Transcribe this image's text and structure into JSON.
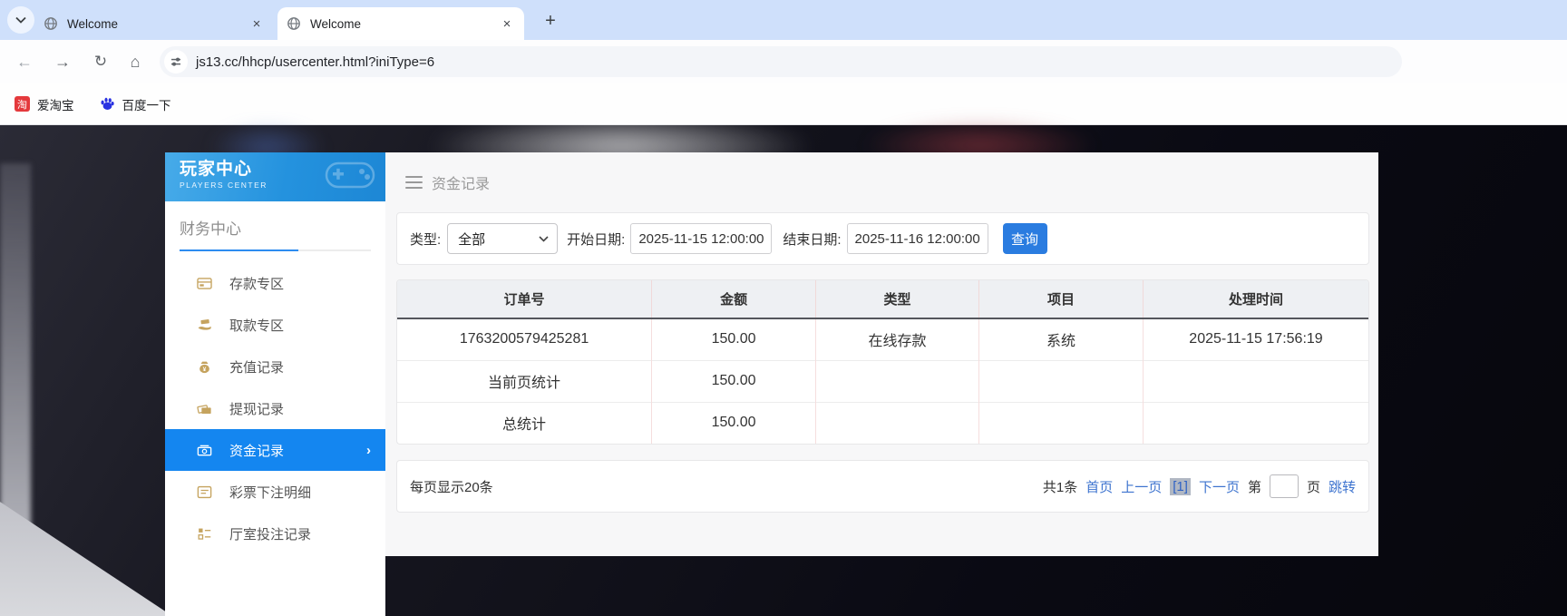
{
  "browser": {
    "tabs": [
      {
        "title": "Welcome"
      },
      {
        "title": "Welcome"
      }
    ],
    "url": "js13.cc/hhcp/usercenter.html?iniType=6",
    "bookmarks": [
      {
        "label": "爱淘宝"
      },
      {
        "label": "百度一下"
      }
    ]
  },
  "icons": {
    "close": "×",
    "new_tab": "+",
    "back": "←",
    "forward": "→",
    "reload": "↻",
    "home": "⌂",
    "taobao": "淘",
    "active_chevron": "›",
    "collapse_chevron": "›"
  },
  "sidebar": {
    "title": "玩家中心",
    "subtitle": "PLAYERS CENTER",
    "section": "财务中心",
    "items": [
      {
        "label": "存款专区"
      },
      {
        "label": "取款专区"
      },
      {
        "label": "充值记录"
      },
      {
        "label": "提现记录"
      },
      {
        "label": "资金记录"
      },
      {
        "label": "彩票下注明细"
      },
      {
        "label": "厅室投注记录"
      }
    ]
  },
  "main": {
    "title": "资金记录",
    "filter": {
      "type_label": "类型:",
      "type_value": "全部",
      "start_label": "开始日期:",
      "start_value": "2025-11-15 12:00:00",
      "end_label": "结束日期:",
      "end_value": "2025-11-16 12:00:00",
      "search_label": "查询"
    },
    "table": {
      "headers": [
        "订单号",
        "金额",
        "类型",
        "项目",
        "处理时间"
      ],
      "rows": [
        [
          "1763200579425281",
          "150.00",
          "在线存款",
          "系统",
          "2025-11-15 17:56:19"
        ],
        [
          "当前页统计",
          "150.00",
          "",
          "",
          ""
        ],
        [
          "总统计",
          "150.00",
          "",
          "",
          ""
        ]
      ]
    },
    "pagination": {
      "page_size": "每页显示20条",
      "total": "共1条",
      "first": "首页",
      "prev": "上一页",
      "current": "[1]",
      "next": "下一页",
      "jump_pre": "第",
      "jump_post": "页",
      "jump": "跳转"
    }
  },
  "colors": {
    "accent_blue": "#1486f0",
    "link_blue": "#3e74cf",
    "button_blue": "#2a7ce0",
    "icon_gold": "#c5a35e",
    "header_gradient_start": "#47abe9",
    "header_gradient_end": "#1d87d5"
  }
}
